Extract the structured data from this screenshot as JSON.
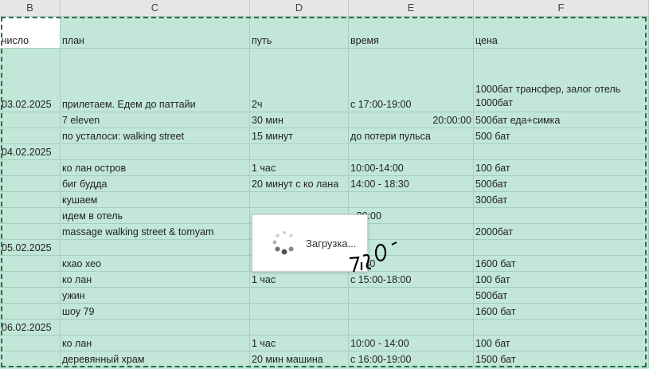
{
  "columns": [
    "B",
    "C",
    "D",
    "E",
    "F"
  ],
  "header": {
    "b": "число",
    "c": "план",
    "d": "путь",
    "e": "время",
    "f": "цена"
  },
  "rows": [
    {
      "b": "03.02.2025",
      "c": "прилетаем. Едем до паттайи",
      "d": "2ч",
      "e": "с 17:00-19:00",
      "f": "1000бат трансфер,       залог отель 1000бат"
    },
    {
      "b": "",
      "c": "7 eleven",
      "d": "30  мин",
      "e": "20:00:00",
      "f": "500бат еда+симка"
    },
    {
      "b": "",
      "c": "по усталоси: walking street",
      "d": "15 минут",
      "e": "до потери пульса",
      "f": "500 бат"
    },
    {
      "b": "04.02.2025",
      "c": "",
      "d": "",
      "e": "",
      "f": ""
    },
    {
      "b": "",
      "c": "ко лан остров",
      "d": "1 час",
      "e": "10:00-14:00",
      "f": "100 бат"
    },
    {
      "b": "",
      "c": "биг будда",
      "d": "20 минут с ко лана",
      "e": "14:00 - 18:30",
      "f": "500бат"
    },
    {
      "b": "",
      "c": "кушаем",
      "d": "",
      "e": "",
      "f": "300бат"
    },
    {
      "b": "",
      "c": "идем в отель",
      "d": "",
      "e": "- 20:00",
      "f": ""
    },
    {
      "b": "",
      "c": "massage walking street & tomyam",
      "d": "",
      "e": "",
      "f": "2000бат"
    },
    {
      "b": "05.02.2025",
      "c": "",
      "d": "",
      "e": "",
      "f": ""
    },
    {
      "b": "",
      "c": "кхао хео",
      "d": "",
      "e": "14:30",
      "f": "1600 бат"
    },
    {
      "b": "",
      "c": "ко лан",
      "d": "1 час",
      "e": "с 15:00-18:00",
      "f": "100 бат"
    },
    {
      "b": "",
      "c": "ужин",
      "d": "",
      "e": "",
      "f": "500бат"
    },
    {
      "b": "",
      "c": "шоу 79",
      "d": "",
      "e": "",
      "f": "1600 бат"
    },
    {
      "b": "06.02.2025",
      "c": "",
      "d": "",
      "e": "",
      "f": ""
    },
    {
      "b": "",
      "c": "ко лан",
      "d": "1 час",
      "e": "10:00 - 14:00",
      "f": "100 бат"
    },
    {
      "b": "",
      "c": "деревянный храм",
      "d": "20 мин машина",
      "e": "с 16:00-19:00",
      "f": "1500 бат"
    }
  ],
  "popup": {
    "text": "Загрузка...",
    "icon": "spinner-icon"
  },
  "colors": {
    "fill": "#c2e6d7",
    "selection": "#1e7145",
    "header": "#e6e6e6"
  }
}
